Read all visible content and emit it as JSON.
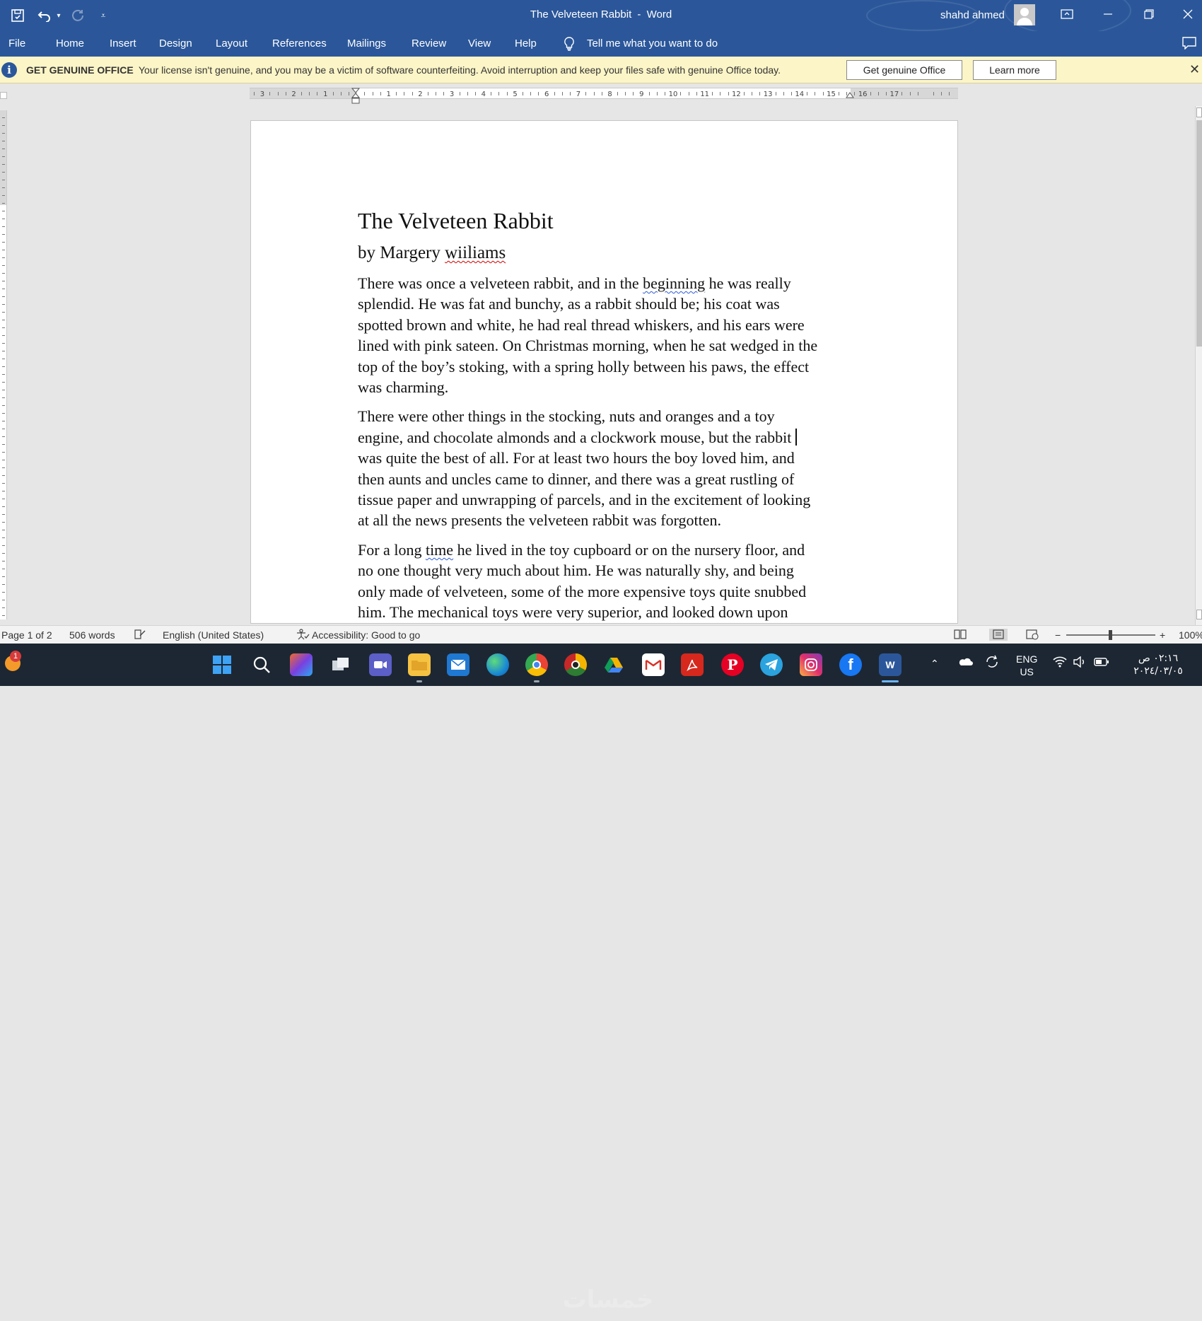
{
  "titlebar": {
    "doc_title": "The Velveteen Rabbit",
    "separator": "-",
    "app_name": "Word",
    "user_name": "shahd ahmed"
  },
  "menu": {
    "items": [
      "File",
      "Home",
      "Insert",
      "Design",
      "Layout",
      "References",
      "Mailings",
      "Review",
      "View",
      "Help"
    ],
    "tell_me": "Tell me what you want to do"
  },
  "infobar": {
    "title": "GET GENUINE OFFICE",
    "message": "Your license isn't genuine, and you may be a victim of software counterfeiting. Avoid interruption and keep your files safe with genuine Office today.",
    "get_button": "Get genuine Office",
    "learn_button": "Learn more"
  },
  "ruler": {
    "left_ticks": [
      "3",
      "2",
      "1"
    ],
    "right_ticks": [
      "1",
      "2",
      "3",
      "4",
      "5",
      "6",
      "7",
      "8",
      "9",
      "10",
      "11",
      "12",
      "13",
      "14",
      "15",
      "16",
      "17"
    ]
  },
  "document": {
    "title": "The Velveteen Rabbit",
    "byline_prefix": "by Margery",
    "byline_name": "wiiliams",
    "p1": {
      "l1a": "There was once a velveteen rabbit, and in the ",
      "l1w": "beginning",
      "l1b": " he was really",
      "l2": "splendid. He was fat and bunchy, as a rabbit should be; his coat was",
      "l3": "spotted brown and white, he had real thread whiskers, and his ears were",
      "l4": "lined with pink sateen. On Christmas morning, when he sat wedged in the",
      "l5": "top of the boy’s stoking, with a spring holly between his paws, the effect",
      "l6": "was charming."
    },
    "p2": {
      "l1": "There were other things in the stocking, nuts and oranges and a toy",
      "l2": "engine, and chocolate almonds and a clockwork mouse, but the rabbit",
      "l3": "was quite the best of all. For at least two hours the boy loved him, and",
      "l4": "then aunts and uncles came to dinner, and there was a great rustling of",
      "l5": "tissue paper and unwrapping of parcels, and in the excitement of looking",
      "l6": "at all the news presents the velveteen rabbit was forgotten."
    },
    "p3": {
      "l1a": "For a long ",
      "l1w": "time",
      "l1b": " he lived in the toy cupboard or on the nursery floor, and",
      "l2": "no one thought very much about him. He was naturally shy, and being",
      "l3": "only made of velveteen, some of the more expensive toys quite snubbed",
      "l4": "him. The mechanical toys were very superior, and looked down upon"
    }
  },
  "status": {
    "page": "Page 1 of 2",
    "words": "506 words",
    "language": "English (United States)",
    "accessibility": "Accessibility: Good to go",
    "zoom_minus": "−",
    "zoom_plus": "+",
    "zoom": "100%"
  },
  "taskbar": {
    "notification_count": "1",
    "lang_top": "ENG",
    "lang_bottom": "US",
    "time": "٠٢:١٦ ص",
    "date": "٢٠٢٤/٠٣/٠٥",
    "watermark": "خمسات"
  },
  "colors": {
    "ribbon": "#2b579a",
    "infobar": "#fcf5c7",
    "spell_error": "#d00000",
    "grammar_error": "#2e5bd8",
    "taskbar": "#1d2733"
  },
  "icons": {
    "quick_access": [
      "autosave-icon",
      "undo-icon",
      "redo-icon",
      "customize-icon"
    ],
    "window": [
      "ribbon-display-icon",
      "minimize-icon",
      "restore-icon",
      "close-icon"
    ],
    "taskbar_apps": [
      "windows-start-icon",
      "search-icon",
      "copilot-icon",
      "task-view-icon",
      "teams-icon",
      "file-explorer-icon",
      "mail-icon",
      "edge-icon",
      "chrome-icon",
      "chrome-canary-icon",
      "google-drive-icon",
      "gmail-icon",
      "acrobat-icon",
      "pinterest-icon",
      "telegram-icon",
      "instagram-icon",
      "facebook-icon",
      "word-icon"
    ]
  }
}
